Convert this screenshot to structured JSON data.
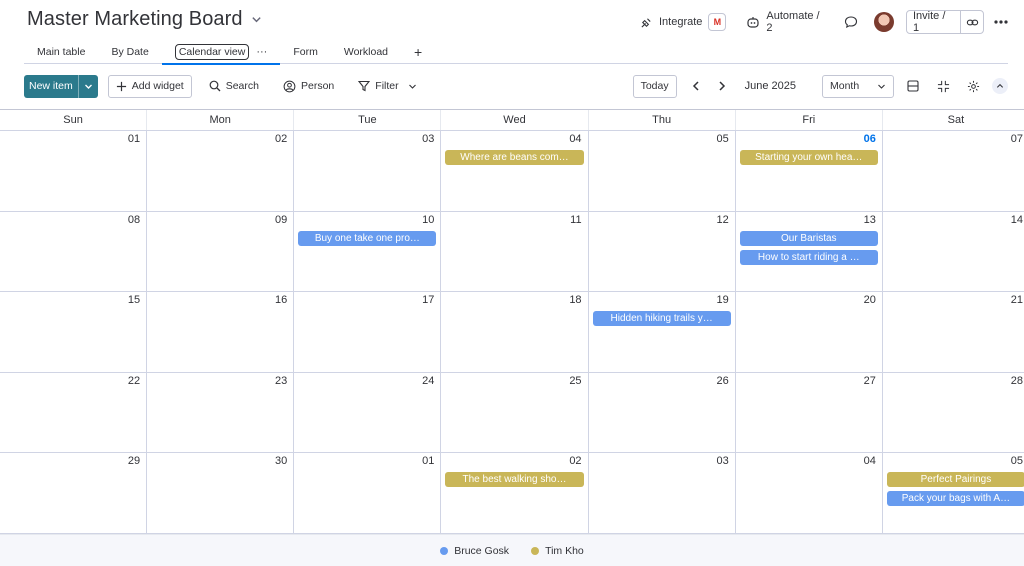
{
  "header": {
    "title": "Master Marketing Board",
    "integrate_label": "Integrate",
    "gmail_letter": "M",
    "automate_label": "Automate / 2",
    "invite_label": "Invite / 1"
  },
  "tabs": [
    {
      "label": "Main table"
    },
    {
      "label": "By Date"
    },
    {
      "label": "Calendar view",
      "active": true
    },
    {
      "label": "Form"
    },
    {
      "label": "Workload"
    }
  ],
  "toolbar": {
    "new_item": "New item",
    "add_widget": "Add widget",
    "search": "Search",
    "person": "Person",
    "filter": "Filter",
    "today": "Today",
    "month_label": "June 2025",
    "view_select": "Month"
  },
  "colors": {
    "bruce": "#679bef",
    "tim": "#c9b658",
    "accent": "#0073ea",
    "new_item_bg": "#2b7a8c"
  },
  "calendar": {
    "days_of_week": [
      "Sun",
      "Mon",
      "Tue",
      "Wed",
      "Thu",
      "Fri",
      "Sat"
    ],
    "weeks": [
      [
        "01",
        "02",
        "03",
        "04",
        "05",
        "06",
        "07"
      ],
      [
        "08",
        "09",
        "10",
        "11",
        "12",
        "13",
        "14"
      ],
      [
        "15",
        "16",
        "17",
        "18",
        "19",
        "20",
        "21"
      ],
      [
        "22",
        "23",
        "24",
        "25",
        "26",
        "27",
        "28"
      ],
      [
        "29",
        "30",
        "01",
        "02",
        "03",
        "04",
        "05"
      ]
    ],
    "today": {
      "week": 0,
      "day": 5
    },
    "events": [
      {
        "week": 0,
        "day": 3,
        "slot": 0,
        "title": "Where are beans com…",
        "owner": "tim"
      },
      {
        "week": 0,
        "day": 5,
        "slot": 0,
        "title": "Starting your own hea…",
        "owner": "tim"
      },
      {
        "week": 1,
        "day": 2,
        "slot": 0,
        "title": "Buy one take one pro…",
        "owner": "bruce"
      },
      {
        "week": 1,
        "day": 5,
        "slot": 0,
        "title": "Our Baristas",
        "owner": "bruce"
      },
      {
        "week": 1,
        "day": 5,
        "slot": 1,
        "title": "How to start riding a …",
        "owner": "bruce"
      },
      {
        "week": 2,
        "day": 4,
        "slot": 0,
        "title": "Hidden hiking trails y…",
        "owner": "bruce"
      },
      {
        "week": 4,
        "day": 3,
        "slot": 0,
        "title": "The best walking sho…",
        "owner": "tim"
      },
      {
        "week": 4,
        "day": 6,
        "slot": 0,
        "title": "Perfect Pairings",
        "owner": "tim"
      },
      {
        "week": 4,
        "day": 6,
        "slot": 1,
        "title": "Pack your bags with A…",
        "owner": "bruce"
      }
    ]
  },
  "legend": [
    {
      "name": "Bruce Gosk",
      "owner": "bruce"
    },
    {
      "name": "Tim Kho",
      "owner": "tim"
    }
  ]
}
